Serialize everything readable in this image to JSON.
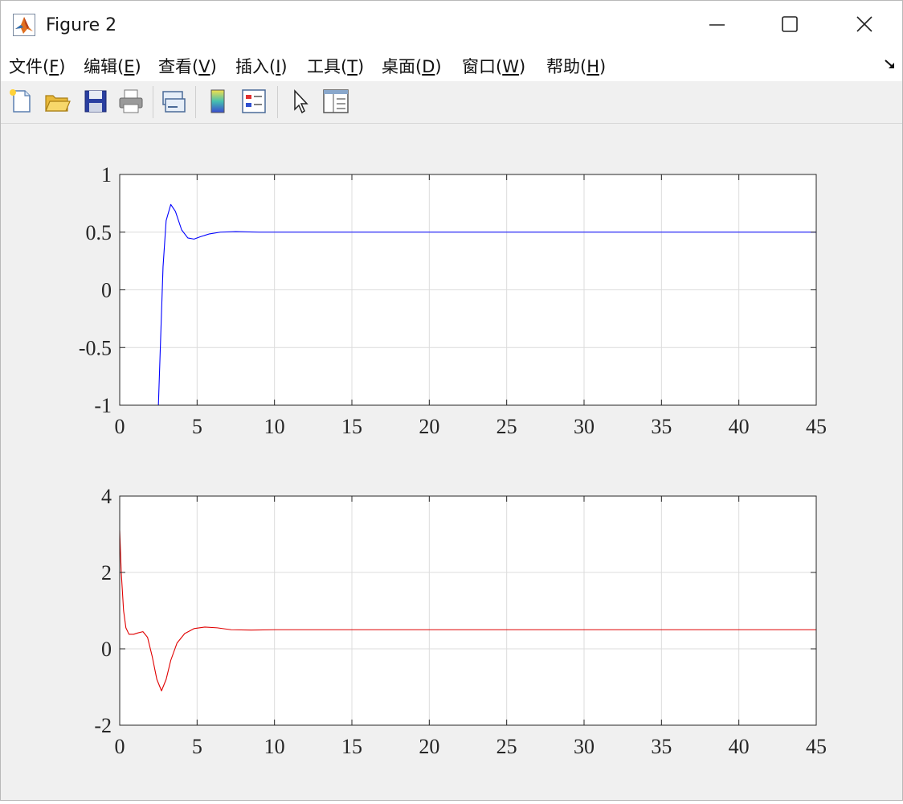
{
  "window": {
    "title": "Figure 2"
  },
  "menubar": {
    "items": [
      {
        "label": "文件(",
        "key": "F",
        "suffix": ")"
      },
      {
        "label": "编辑(",
        "key": "E",
        "suffix": ")"
      },
      {
        "label": "查看(",
        "key": "V",
        "suffix": ")"
      },
      {
        "label": "插入(",
        "key": "I",
        "suffix": ")"
      },
      {
        "label": "工具(",
        "key": "T",
        "suffix": ")"
      },
      {
        "label": "桌面(",
        "key": "D",
        "suffix": ")"
      },
      {
        "label": "窗口(",
        "key": "W",
        "suffix": ")"
      },
      {
        "label": "帮助(",
        "key": "H",
        "suffix": ")"
      }
    ]
  },
  "toolbar": {
    "icons": [
      "new-figure-icon",
      "open-file-icon",
      "save-icon",
      "print-icon",
      "link-plot-icon",
      "colorbar-icon",
      "legend-icon",
      "pointer-icon",
      "property-inspector-icon"
    ]
  },
  "chart_data": [
    {
      "type": "line",
      "xlim": [
        0,
        45
      ],
      "ylim": [
        -1,
        1
      ],
      "xticks": [
        0,
        5,
        10,
        15,
        20,
        25,
        30,
        35,
        40,
        45
      ],
      "yticks": [
        -1,
        -0.5,
        0,
        0.5,
        1
      ],
      "xtick_labels": [
        "0",
        "5",
        "10",
        "15",
        "20",
        "25",
        "30",
        "35",
        "40",
        "45"
      ],
      "ytick_labels": [
        "-1",
        "-0.5",
        "0",
        "0.5",
        "1"
      ],
      "grid": true,
      "series": [
        {
          "color": "#0000ff",
          "x": [
            0,
            2.0,
            2.5,
            2.6,
            2.8,
            3.0,
            3.3,
            3.6,
            4.0,
            4.4,
            4.8,
            5.2,
            5.8,
            6.5,
            7.5,
            9.0,
            45
          ],
          "y": [
            -1,
            -1,
            -1,
            -0.6,
            0.2,
            0.6,
            0.74,
            0.68,
            0.52,
            0.45,
            0.44,
            0.46,
            0.485,
            0.5,
            0.505,
            0.5,
            0.5
          ]
        }
      ]
    },
    {
      "type": "line",
      "xlim": [
        0,
        45
      ],
      "ylim": [
        -2,
        4
      ],
      "xticks": [
        0,
        5,
        10,
        15,
        20,
        25,
        30,
        35,
        40,
        45
      ],
      "yticks": [
        -2,
        0,
        2,
        4
      ],
      "xtick_labels": [
        "0",
        "5",
        "10",
        "15",
        "20",
        "25",
        "30",
        "35",
        "40",
        "45"
      ],
      "ytick_labels": [
        "-2",
        "0",
        "2",
        "4"
      ],
      "grid": true,
      "series": [
        {
          "color": "#e00000",
          "x": [
            0,
            0.1,
            0.25,
            0.4,
            0.6,
            0.9,
            1.2,
            1.5,
            1.8,
            2.1,
            2.4,
            2.7,
            3.0,
            3.3,
            3.7,
            4.2,
            4.8,
            5.5,
            6.3,
            7.2,
            8.5,
            10,
            45
          ],
          "y": [
            3.1,
            2.0,
            1.0,
            0.55,
            0.38,
            0.38,
            0.42,
            0.45,
            0.3,
            -0.2,
            -0.8,
            -1.1,
            -0.8,
            -0.3,
            0.15,
            0.4,
            0.53,
            0.57,
            0.55,
            0.5,
            0.49,
            0.5,
            0.5
          ]
        }
      ]
    }
  ]
}
